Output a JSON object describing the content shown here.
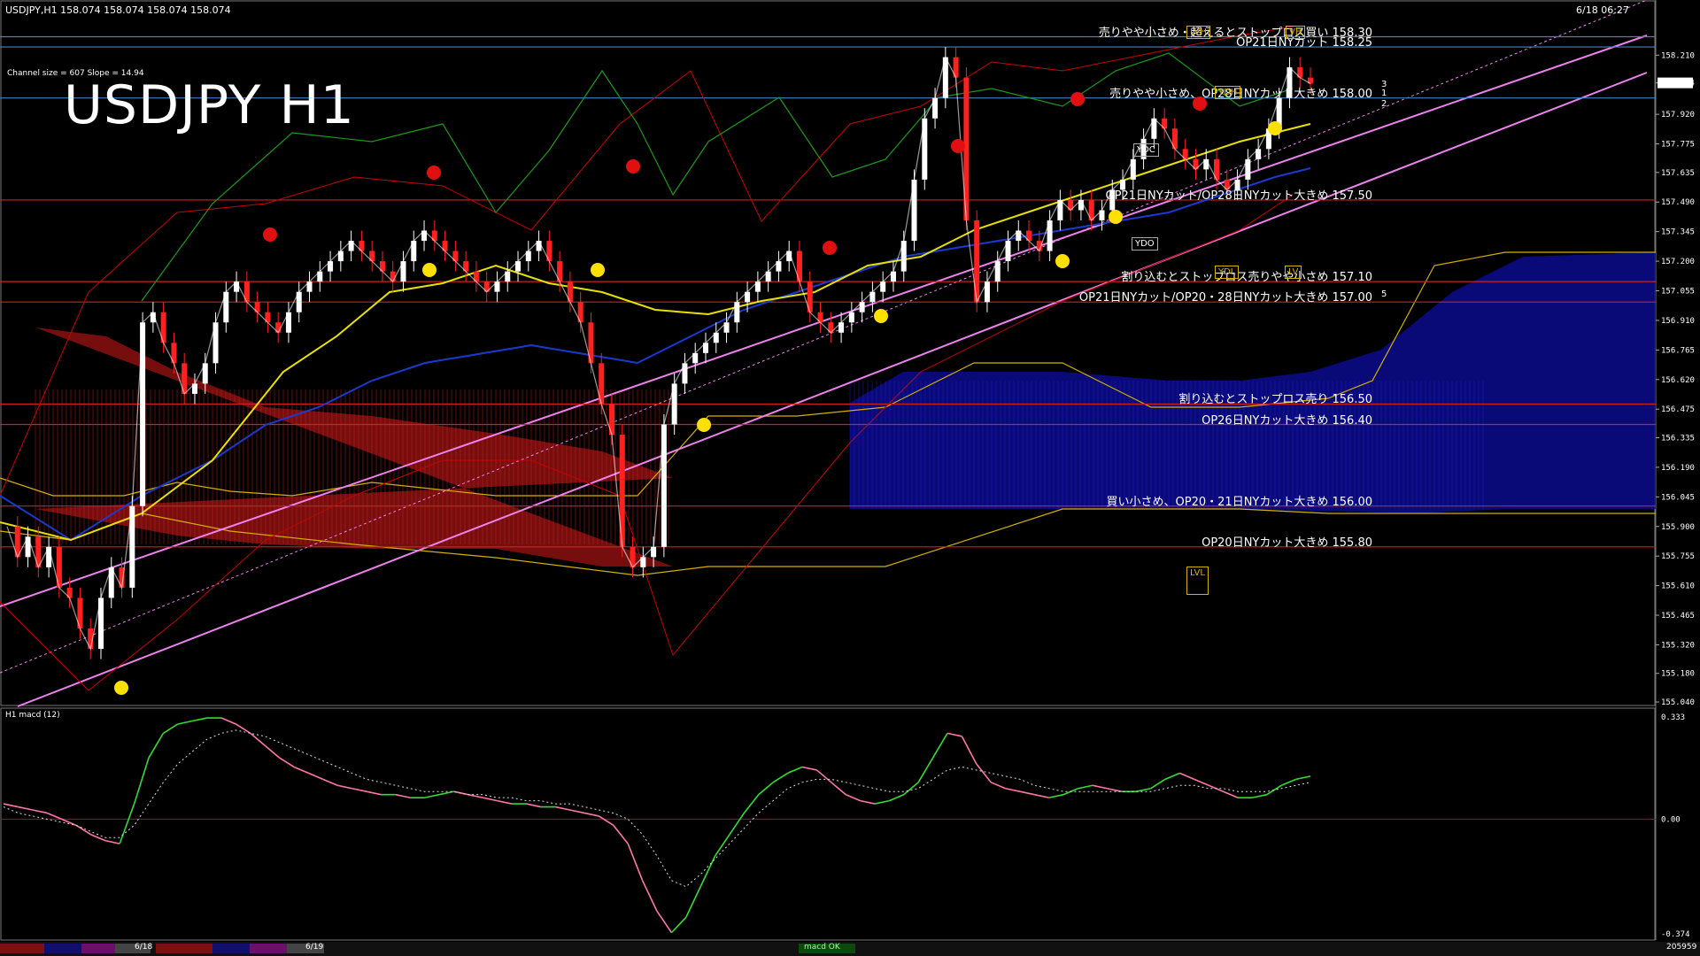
{
  "header": {
    "symbol_line": "USDJPY,H1  158.074 158.074 158.074 158.074",
    "datetime": "6/18 06:27",
    "channel_info": "Channel size = 607  Slope = 14.94",
    "big_title": "USDJPY H1"
  },
  "levels": [
    {
      "label": "売りやや小さめ・超えるとストップロス買い 158.30",
      "price": 158.3,
      "color": "#4a7fc0"
    },
    {
      "label": "OP21日NYカット 158.25",
      "price": 158.25,
      "color": "#4a7fc0"
    },
    {
      "label": "売りやや小さめ、OP28日NYカット大きめ 158.00",
      "price": 158.0,
      "color": "#4a7fc0"
    },
    {
      "label": "OP21日NYカット/OP28日NYカット大きめ 157.50",
      "price": 157.5,
      "color": "#cc2222"
    },
    {
      "label": "割り込むとストップロス売りやや小さめ 157.10",
      "price": 157.1,
      "color": "#cc2222"
    },
    {
      "label": "OP21日NYカット/OP20・28日NYカット大きめ 157.00",
      "price": 157.0,
      "color": "#cc2222"
    },
    {
      "label": "割り込むとストップロス売り 156.50",
      "price": 156.5,
      "color": "#cc2222"
    },
    {
      "label": "OP26日NYカット大きめ 156.40",
      "price": 156.4,
      "color": "#cc2222"
    },
    {
      "label": "買い小さめ、OP20・21日NYカット大きめ 156.00",
      "price": 156.0,
      "color": "#cc2222"
    },
    {
      "label": "OP20日NYカット大きめ 155.80",
      "price": 155.8,
      "color": "#cc2222"
    }
  ],
  "badges": {
    "lvh": "LVH",
    "ydh": "YDH",
    "ydc": "YDC",
    "ydo": "YDO",
    "ydl": "YDL",
    "lv": "LV",
    "lvl": "LVL",
    "vh": "VH"
  },
  "channel_marks": [
    "3",
    "1",
    "2",
    "5"
  ],
  "macd": {
    "label": "H1  macd (12)",
    "ticks": [
      "0.333",
      "0.00",
      "-0.374"
    ]
  },
  "bottom": {
    "dates": [
      "6/18",
      "6/19"
    ],
    "button": "macd OK",
    "counter": "205959"
  },
  "chart_data": {
    "type": "line",
    "title": "USDJPY H1",
    "y_ticks": [
      158.21,
      158.074,
      157.92,
      157.775,
      157.635,
      157.49,
      157.345,
      157.2,
      157.055,
      156.91,
      156.765,
      156.62,
      156.475,
      156.335,
      156.19,
      156.045,
      155.9,
      155.755,
      155.61,
      155.465,
      155.32,
      155.18,
      155.04
    ],
    "current_price": "158.074",
    "ylim": [
      155.04,
      158.35
    ],
    "price_series": [
      {
        "name": "",
        "color": "#ffffff",
        "values": [
          155.9,
          155.75,
          155.85,
          155.7,
          155.8,
          155.6,
          155.55,
          155.4,
          155.3,
          155.55,
          155.7,
          155.6,
          156.0,
          156.9,
          156.95,
          156.8,
          156.7,
          156.55,
          156.6,
          156.7,
          156.9,
          157.05,
          157.1,
          157.0,
          156.95,
          156.9,
          156.85,
          156.95,
          157.05,
          157.1,
          157.15,
          157.2,
          157.25,
          157.3,
          157.25,
          157.2,
          157.15,
          157.1,
          157.2,
          157.3,
          157.35,
          157.3,
          157.25,
          157.2,
          157.15,
          157.1,
          157.05,
          157.1,
          157.15,
          157.2,
          157.25,
          157.3,
          157.2,
          157.1,
          157.0,
          156.9,
          156.7,
          156.5,
          156.35,
          155.8,
          155.7,
          155.75,
          155.8,
          156.4,
          156.6,
          156.7,
          156.75,
          156.8,
          156.85,
          156.9,
          157.0,
          157.05,
          157.1,
          157.15,
          157.2,
          157.25,
          157.1,
          156.95,
          156.9,
          156.85,
          156.9,
          156.95,
          157.0,
          157.05,
          157.1,
          157.15,
          157.3,
          157.6,
          157.9,
          158.0,
          158.2,
          158.1,
          157.4,
          157.0,
          157.1,
          157.2,
          157.3,
          157.35,
          157.3,
          157.25,
          157.4,
          157.5,
          157.45,
          157.5,
          157.4,
          157.45,
          157.55,
          157.6,
          157.7,
          157.8,
          157.9,
          157.85,
          157.75,
          157.7,
          157.65,
          157.7,
          157.6,
          157.55,
          157.6,
          157.7,
          157.75,
          157.85,
          158.0,
          158.15,
          158.1,
          158.07
        ]
      }
    ],
    "macd_series": {
      "main": [
        0.05,
        0.04,
        0.03,
        0.02,
        0.0,
        -0.02,
        -0.05,
        -0.07,
        -0.08,
        0.05,
        0.2,
        0.28,
        0.31,
        0.32,
        0.33,
        0.33,
        0.31,
        0.28,
        0.24,
        0.2,
        0.17,
        0.15,
        0.13,
        0.11,
        0.1,
        0.09,
        0.08,
        0.08,
        0.07,
        0.07,
        0.08,
        0.09,
        0.08,
        0.07,
        0.06,
        0.05,
        0.05,
        0.04,
        0.04,
        0.03,
        0.02,
        0.01,
        -0.02,
        -0.08,
        -0.2,
        -0.3,
        -0.37,
        -0.32,
        -0.22,
        -0.12,
        -0.05,
        0.02,
        0.08,
        0.12,
        0.15,
        0.17,
        0.16,
        0.12,
        0.08,
        0.06,
        0.05,
        0.06,
        0.08,
        0.12,
        0.2,
        0.28,
        0.27,
        0.18,
        0.12,
        0.1,
        0.09,
        0.08,
        0.07,
        0.08,
        0.1,
        0.11,
        0.1,
        0.09,
        0.09,
        0.1,
        0.13,
        0.15,
        0.13,
        0.11,
        0.09,
        0.07,
        0.07,
        0.08,
        0.11,
        0.13,
        0.14
      ],
      "signal": [
        0.04,
        0.02,
        0.01,
        0.0,
        -0.01,
        -0.02,
        -0.04,
        -0.06,
        -0.06,
        -0.02,
        0.05,
        0.12,
        0.18,
        0.22,
        0.26,
        0.28,
        0.29,
        0.28,
        0.27,
        0.25,
        0.23,
        0.21,
        0.19,
        0.17,
        0.15,
        0.13,
        0.12,
        0.11,
        0.1,
        0.09,
        0.09,
        0.09,
        0.08,
        0.08,
        0.07,
        0.07,
        0.06,
        0.06,
        0.05,
        0.05,
        0.04,
        0.03,
        0.02,
        0.0,
        -0.05,
        -0.12,
        -0.2,
        -0.22,
        -0.18,
        -0.13,
        -0.08,
        -0.03,
        0.02,
        0.06,
        0.1,
        0.12,
        0.13,
        0.13,
        0.12,
        0.11,
        0.1,
        0.09,
        0.09,
        0.1,
        0.13,
        0.16,
        0.17,
        0.16,
        0.15,
        0.14,
        0.13,
        0.11,
        0.1,
        0.09,
        0.09,
        0.09,
        0.09,
        0.09,
        0.09,
        0.09,
        0.1,
        0.11,
        0.11,
        0.1,
        0.1,
        0.09,
        0.09,
        0.09,
        0.1,
        0.11,
        0.12
      ]
    }
  }
}
